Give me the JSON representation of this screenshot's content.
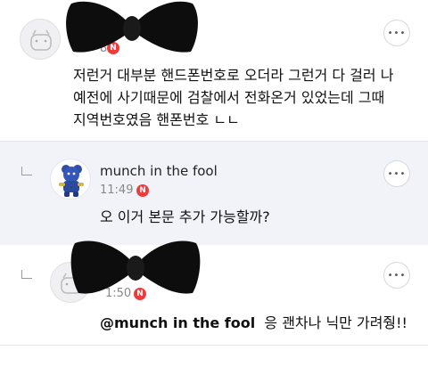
{
  "comments": [
    {
      "nickname": "",
      "time": "",
      "time_partial": "8",
      "badge": "N",
      "body_lines": [
        "저런거 대부분 핸드폰번호로 오더라 그런거 다 걸러 나",
        "예전에 사기때문에 검찰에서 전화온거 있었는데 그때",
        "지역번호였음 핸폰번호 ㄴㄴ"
      ],
      "more": "•••"
    },
    {
      "nickname": "munch in the fool",
      "time": "11:49",
      "badge": "N",
      "body": "오 이거 본문 추가 가능할까?",
      "more": "•••"
    },
    {
      "nickname": "",
      "time_partial": "1:50",
      "badge": "N",
      "mention": "@munch in the fool",
      "body": "응 괜차나 닉만 가려줭!!",
      "more": "•••"
    }
  ],
  "colors": {
    "badge": "#ef3b3b",
    "reply_bg": "#f2f3f8",
    "mask": "#0d0d0d"
  },
  "icons": [
    "reply-arrow-icon",
    "more-options-icon",
    "new-badge-icon",
    "bowtie-mask"
  ]
}
